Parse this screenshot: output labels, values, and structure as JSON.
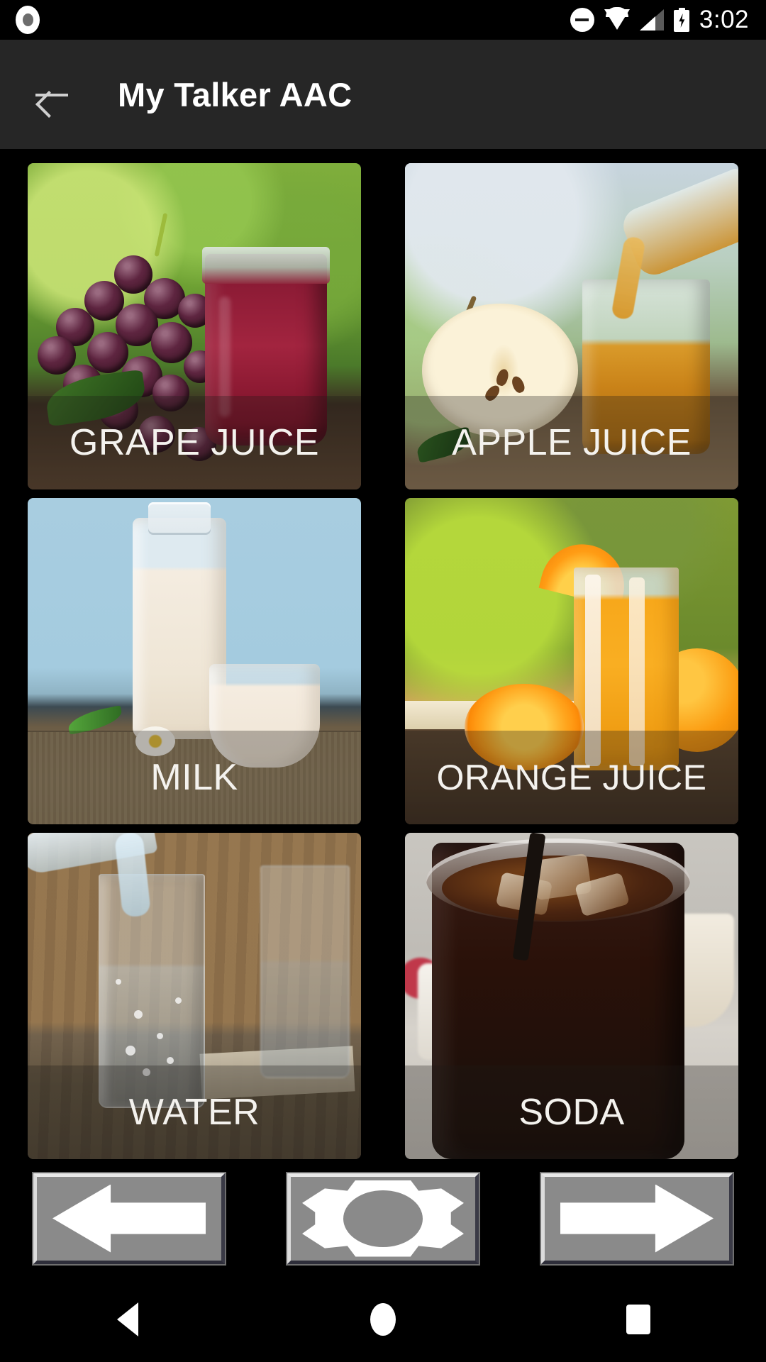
{
  "status_bar": {
    "recording_icon": "record-dot-icon",
    "dnd_icon": "do-not-disturb-icon",
    "wifi_icon": "wifi-icon",
    "signal_icon": "cell-signal-icon",
    "battery_icon": "battery-charging-icon",
    "time": "3:02"
  },
  "app_bar": {
    "back_icon": "back-arrow-icon",
    "title": "My Talker AAC"
  },
  "grid": {
    "cells": [
      {
        "label": "GRAPE JUICE",
        "scene": "sc-grape"
      },
      {
        "label": "APPLE JUICE",
        "scene": "sc-apple"
      },
      {
        "label": "MILK",
        "scene": "sc-milk"
      },
      {
        "label": "ORANGE JUICE",
        "scene": "sc-oj"
      },
      {
        "label": "WATER",
        "scene": "sc-water"
      },
      {
        "label": "SODA",
        "scene": "sc-soda"
      }
    ]
  },
  "controls": {
    "previous_page_icon": "arrow-left-icon",
    "settings_icon": "gear-icon",
    "next_page_icon": "arrow-right-icon"
  },
  "nav_bar": {
    "back_icon": "android-back-icon",
    "home_icon": "android-home-icon",
    "recents_icon": "android-recents-icon"
  },
  "colors": {
    "app_bar_bg": "#262626",
    "page_bg": "#000000",
    "label_text": "#f4f2ee",
    "label_band": "rgba(30,26,24,0.30)",
    "control_face": "#8a8a8a",
    "control_icon": "#ffffff"
  }
}
